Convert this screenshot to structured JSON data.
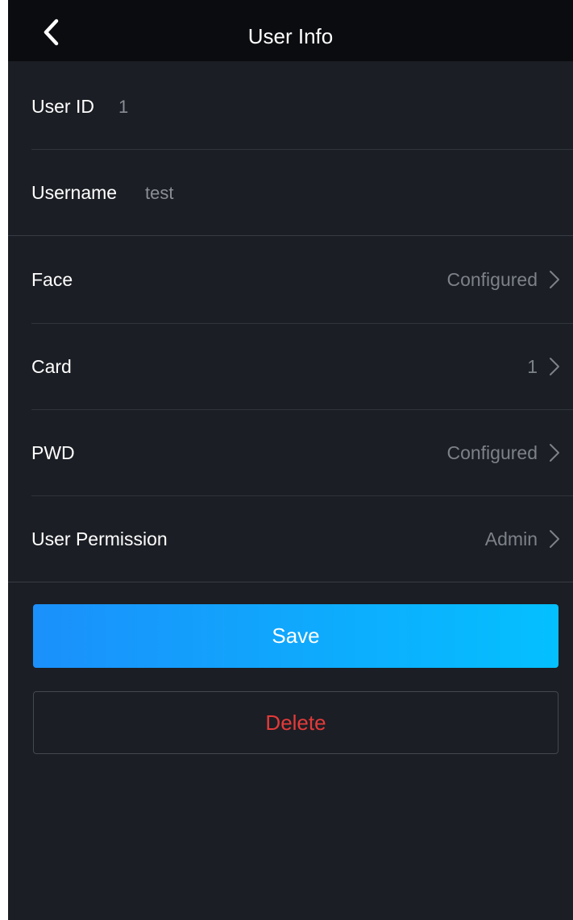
{
  "header": {
    "title": "User Info",
    "back_icon": "chevron-left-icon"
  },
  "fields": {
    "user_id": {
      "label": "User ID",
      "value": "1"
    },
    "username": {
      "label": "Username",
      "value": "test"
    }
  },
  "settings": [
    {
      "label": "Face",
      "value": "Configured",
      "icon": "chevron-right-icon"
    },
    {
      "label": "Card",
      "value": "1",
      "icon": "chevron-right-icon"
    },
    {
      "label": "PWD",
      "value": "Configured",
      "icon": "chevron-right-icon"
    },
    {
      "label": "User Permission",
      "value": "Admin",
      "icon": "chevron-right-icon"
    }
  ],
  "actions": {
    "save_label": "Save",
    "delete_label": "Delete"
  },
  "colors": {
    "background": "#1b1e24",
    "header_background": "#0b0c0f",
    "save_gradient_start": "#1b90fb",
    "save_gradient_end": "#04c0ff",
    "delete_text": "#e43a3a"
  }
}
